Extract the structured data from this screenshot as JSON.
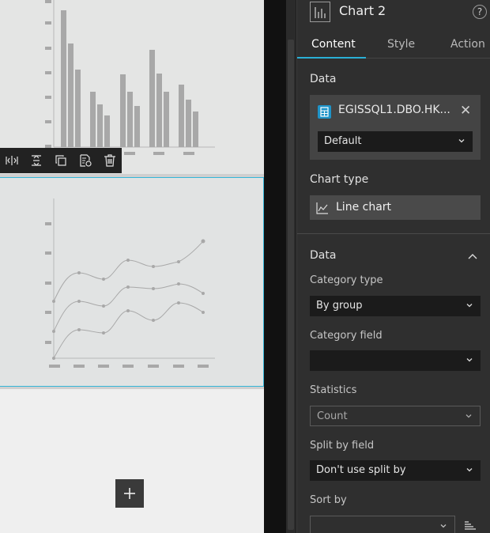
{
  "panel": {
    "title": "Chart 2",
    "help": "?",
    "tabs": [
      "Content",
      "Style",
      "Action"
    ],
    "data_label": "Data",
    "data_source": {
      "name": "EGISSQL1.DBO.HK...",
      "view": "Default"
    },
    "chart_type_label": "Chart type",
    "chart_type_value": "Line chart",
    "data_section": {
      "title": "Data",
      "category_type_label": "Category type",
      "category_type_value": "By group",
      "category_field_label": "Category field",
      "category_field_value": "",
      "statistics_label": "Statistics",
      "statistics_value": "Count",
      "split_label": "Split by field",
      "split_value": "Don't use split by",
      "sort_label": "Sort by",
      "sort_value": ""
    }
  },
  "colors": {
    "accent": "#2ab0d6",
    "panel_bg": "#2f2f2f",
    "canvas_bg": "#e4e5e4",
    "mark_gray": "#a8a8a8"
  },
  "toolbar_icons": [
    "split-icon",
    "distribute-icon",
    "duplicate-icon",
    "edit-data-icon",
    "delete-icon"
  ]
}
